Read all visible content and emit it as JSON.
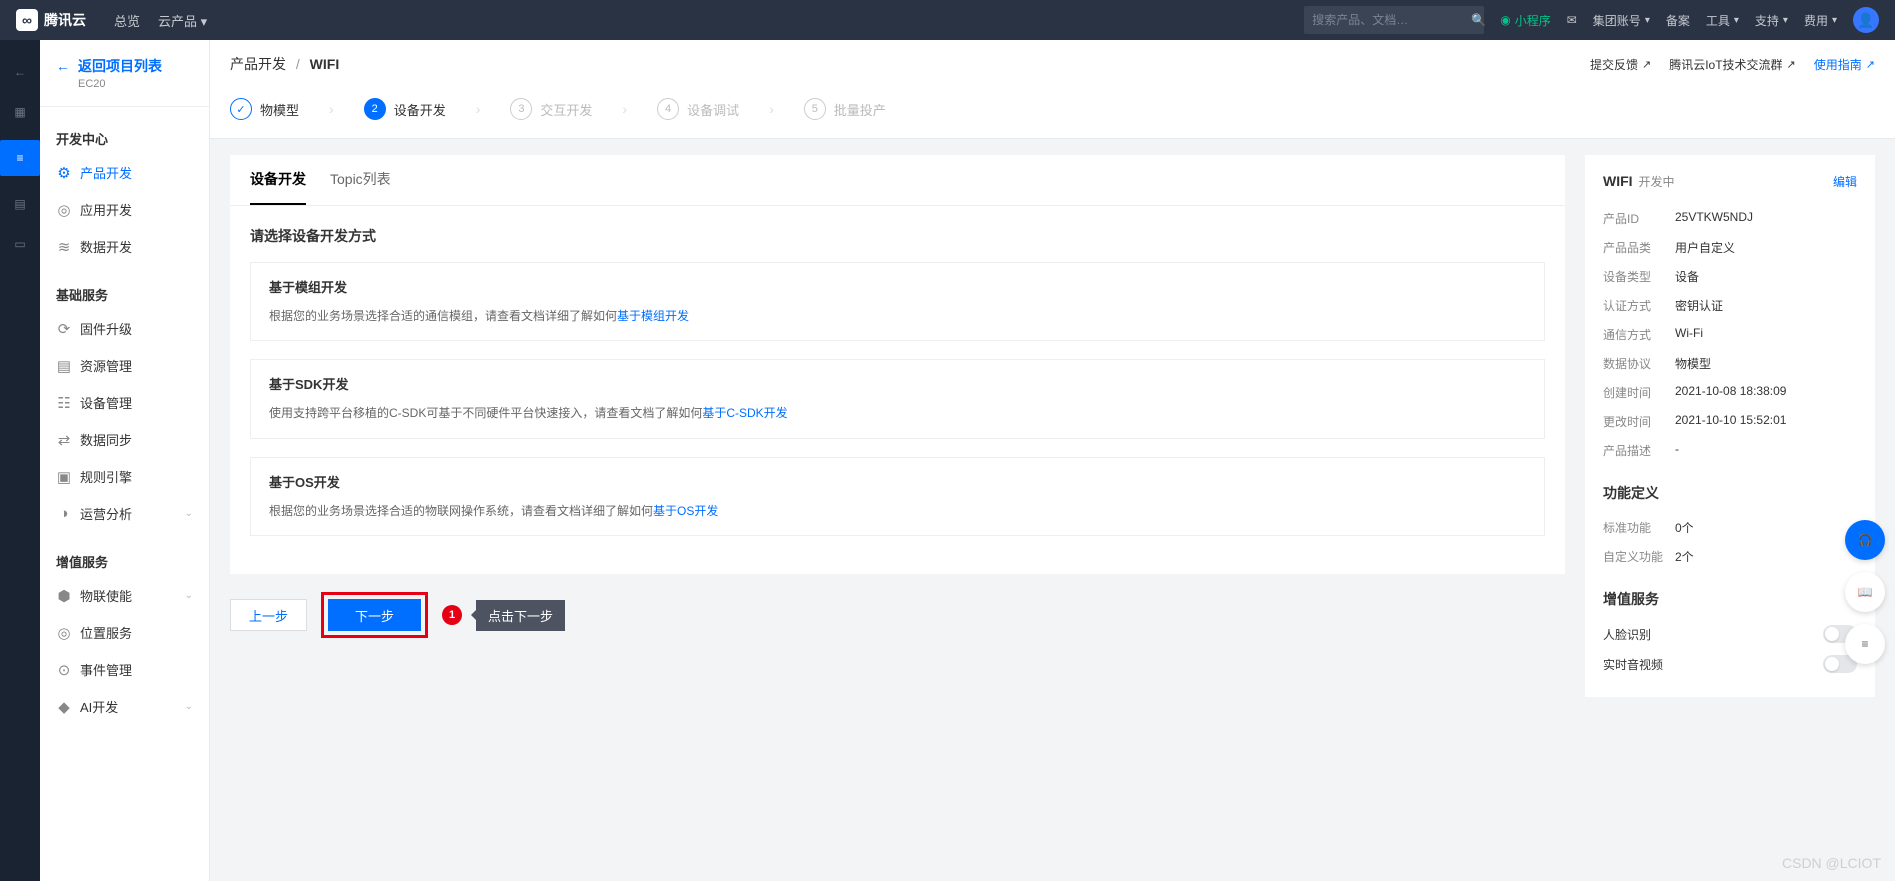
{
  "header": {
    "brand": "腾讯云",
    "primary_nav": [
      "总览",
      "云产品 ▾"
    ],
    "search_placeholder": "搜索产品、文档…",
    "right_items": {
      "xcx": "小程序",
      "mail_icon": "✉",
      "group_account": "集团账号",
      "beian": "备案",
      "tools": "工具",
      "support": "支持",
      "cost": "费用"
    }
  },
  "rail": {
    "icons": [
      "←",
      "▦",
      "≡",
      "▤",
      "▭"
    ]
  },
  "sidebar": {
    "back_label": "返回项目列表",
    "back_sub": "EC20",
    "group_dev": "开发中心",
    "items_dev": [
      {
        "icon": "⚙",
        "label": "产品开发"
      },
      {
        "icon": "◎",
        "label": "应用开发"
      },
      {
        "icon": "≋",
        "label": "数据开发"
      }
    ],
    "group_base": "基础服务",
    "items_base": [
      {
        "icon": "⟳",
        "label": "固件升级"
      },
      {
        "icon": "▤",
        "label": "资源管理"
      },
      {
        "icon": "☷",
        "label": "设备管理"
      },
      {
        "icon": "⇄",
        "label": "数据同步"
      },
      {
        "icon": "▣",
        "label": "规则引擎"
      },
      {
        "icon": "◑",
        "label": "运营分析",
        "chevron": true
      }
    ],
    "group_value": "增值服务",
    "items_value": [
      {
        "icon": "⬢",
        "label": "物联使能",
        "chevron": true
      },
      {
        "icon": "◎",
        "label": "位置服务"
      },
      {
        "icon": "⊙",
        "label": "事件管理"
      },
      {
        "icon": "◆",
        "label": "AI开发",
        "chevron": true
      }
    ]
  },
  "breadcrumb": {
    "b1": "产品开发",
    "sep": "/",
    "b2": "WIFI"
  },
  "quick_links": {
    "feedback": "提交反馈",
    "community": "腾讯云IoT技术交流群",
    "guide": "使用指南"
  },
  "steps": [
    {
      "num": "✓",
      "label": "物模型",
      "state": "done"
    },
    {
      "num": "2",
      "label": "设备开发",
      "state": "active"
    },
    {
      "num": "3",
      "label": "交互开发",
      "state": ""
    },
    {
      "num": "4",
      "label": "设备调试",
      "state": ""
    },
    {
      "num": "5",
      "label": "批量投产",
      "state": ""
    }
  ],
  "tabs": [
    {
      "label": "设备开发",
      "active": true
    },
    {
      "label": "Topic列表",
      "active": false
    }
  ],
  "dev_section": {
    "title": "请选择设备开发方式",
    "cards": [
      {
        "title": "基于模组开发",
        "desc": "根据您的业务场景选择合适的通信模组，请查看文档详细了解如何",
        "link": "基于模组开发"
      },
      {
        "title": "基于SDK开发",
        "desc": "使用支持跨平台移植的C-SDK可基于不同硬件平台快速接入，请查看文档了解如何",
        "link": "基于C-SDK开发"
      },
      {
        "title": "基于OS开发",
        "desc": "根据您的业务场景选择合适的物联网操作系统，请查看文档详细了解如何",
        "link": "基于OS开发"
      }
    ]
  },
  "footer": {
    "prev": "上一步",
    "next": "下一步",
    "annotation_num": "1",
    "annotation_tip": "点击下一步"
  },
  "right_panel": {
    "title": "WIFI",
    "status": "开发中",
    "edit": "编辑",
    "kv": [
      {
        "k": "产品ID",
        "v": "25VTKW5NDJ"
      },
      {
        "k": "产品品类",
        "v": "用户自定义"
      },
      {
        "k": "设备类型",
        "v": "设备"
      },
      {
        "k": "认证方式",
        "v": "密钥认证"
      },
      {
        "k": "通信方式",
        "v": "Wi-Fi"
      },
      {
        "k": "数据协议",
        "v": "物模型"
      },
      {
        "k": "创建时间",
        "v": "2021-10-08 18:38:09"
      },
      {
        "k": "更改时间",
        "v": "2021-10-10 15:52:01"
      },
      {
        "k": "产品描述",
        "v": "-"
      }
    ],
    "feat_title": "功能定义",
    "feat_kv": [
      {
        "k": "标准功能",
        "v": "0个"
      },
      {
        "k": "自定义功能",
        "v": "2个"
      }
    ],
    "value_title": "增值服务",
    "toggles": [
      {
        "label": "人脸识别"
      },
      {
        "label": "实时音视频"
      }
    ]
  },
  "watermark": "CSDN @LCIOT"
}
